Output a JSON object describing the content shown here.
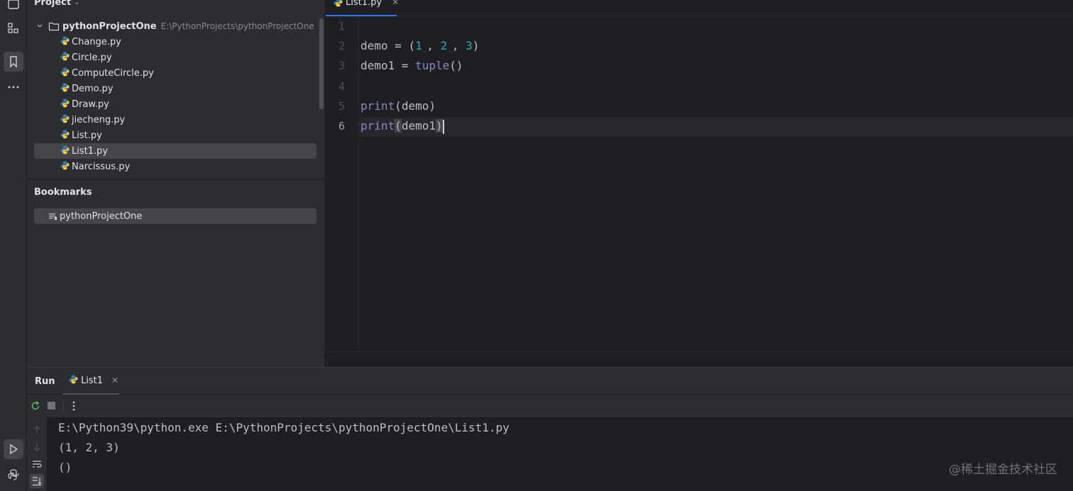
{
  "project_panel": {
    "title": "Project",
    "root": {
      "name": "pythonProjectOne",
      "path": "E:\\PythonProjects\\pythonProjectOne"
    },
    "files": [
      {
        "name": "Change.py"
      },
      {
        "name": "Circle.py"
      },
      {
        "name": "ComputeCircle.py"
      },
      {
        "name": "Demo.py"
      },
      {
        "name": "Draw.py"
      },
      {
        "name": "jiecheng.py"
      },
      {
        "name": "List.py"
      },
      {
        "name": "List1.py",
        "selected": true
      },
      {
        "name": "Narcissus.py"
      }
    ]
  },
  "bookmarks": {
    "title": "Bookmarks",
    "items": [
      {
        "name": "pythonProjectOne"
      }
    ]
  },
  "editor": {
    "tab_label": "List1.py",
    "line_numbers": [
      "1",
      "2",
      "3",
      "4",
      "5",
      "6"
    ],
    "current_line": "6",
    "code": {
      "l2": {
        "var": "demo",
        "eq": " = ",
        "open": "(",
        "n1": "1",
        "s1": ", ",
        "n2": "2",
        "s2": ", ",
        "n3": "3",
        "close": ")"
      },
      "l3": {
        "var": "demo1",
        "eq": " = ",
        "fn": "tuple",
        "args": "()"
      },
      "l5": {
        "fn": "print",
        "open": "(",
        "arg": "demo",
        "close": ")"
      },
      "l6": {
        "fn": "print",
        "open": "(",
        "arg": "demo1",
        "close": ")"
      }
    }
  },
  "run_panel": {
    "title": "Run",
    "tab_label": "List1",
    "console": [
      "E:\\Python39\\python.exe E:\\PythonProjects\\pythonProjectOne\\List1.py",
      "(1, 2, 3)",
      "()"
    ]
  },
  "watermark": "@稀土掘金技术社区",
  "colors": {
    "accent": "#3574f0",
    "number": "#2aacb8",
    "builtin": "#8888c6"
  }
}
